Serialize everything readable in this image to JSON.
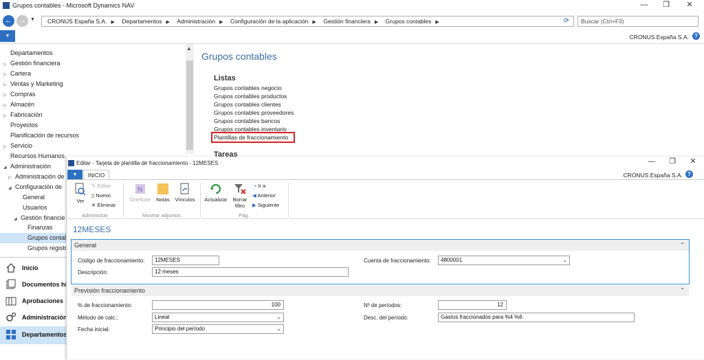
{
  "window": {
    "title": "Grupos contables - Microsoft Dynamics NAV",
    "minimize": "—",
    "maximize": "❐",
    "close": "✕"
  },
  "address": {
    "segments": [
      "CRONUS España S.A.",
      "Departamentos",
      "Administración",
      "Configuración de la aplicación",
      "Gestión financiera",
      "Grupos contables"
    ],
    "search_placeholder": "Buscar (Ctrl+F3)"
  },
  "company": "CRONUS España S.A.",
  "nav": {
    "items": [
      {
        "label": "Departamentos",
        "tri": ""
      },
      {
        "label": "Gestión financiera",
        "tri": "▷"
      },
      {
        "label": "Cartera",
        "tri": "▷"
      },
      {
        "label": "Ventas y Marketing",
        "tri": "▷"
      },
      {
        "label": "Compras",
        "tri": "▷"
      },
      {
        "label": "Almacén",
        "tri": "▷"
      },
      {
        "label": "Fabricación",
        "tri": "▷"
      },
      {
        "label": "Proyectos",
        "tri": ""
      },
      {
        "label": "Planificación de recursos",
        "tri": ""
      },
      {
        "label": "Servicio",
        "tri": "▷"
      },
      {
        "label": "Recursos Humanos",
        "tri": ""
      },
      {
        "label": "Administración",
        "tri": "◢"
      },
      {
        "label": "Administración de",
        "tri": "▷"
      },
      {
        "label": "Configuración de",
        "tri": "◢"
      },
      {
        "label": "General",
        "tri": ""
      },
      {
        "label": "Usuarios",
        "tri": ""
      },
      {
        "label": "Gestión financie",
        "tri": "◢"
      },
      {
        "label": "Finanzas",
        "tri": ""
      },
      {
        "label": "Grupos contal",
        "tri": ""
      },
      {
        "label": "Grupos registr",
        "tri": ""
      }
    ],
    "bottom": [
      "Inicio",
      "Documentos hi",
      "Aprobaciones",
      "Administración",
      "Departamentos"
    ]
  },
  "content": {
    "title": "Grupos contables",
    "listas_header": "Listas",
    "links": [
      "Grupos contables negocio",
      "Grupos contables productos",
      "Grupos contables clientes",
      "Grupos contables proveedores",
      "Grupos contables bancos",
      "Grupos contables inventario",
      "Plantillas de fraccionamiento"
    ],
    "tareas_header": "Tareas"
  },
  "dialog": {
    "title": "Editar - Tarjeta de plantilla de fraccionamiento - 12MESES",
    "tab": "INICIO",
    "ribbon": {
      "ver": "Ver",
      "editar": "Editar",
      "nuevo": "Nuevo",
      "eliminar": "Eliminar",
      "group_administrar": "Administrar",
      "onenote": "OneNote",
      "notas": "Notas",
      "vinculos": "Vínculos",
      "group_adjuntos": "Mostrar adjuntos",
      "actualizar": "Actualizar",
      "borrar_filtro_1": "Borrar",
      "borrar_filtro_2": "filtro",
      "ir_a": "Ir a",
      "anterior": "Anterior",
      "siguiente": "Siguiente",
      "group_pag": "Pág."
    },
    "card_title": "12MESES",
    "general": {
      "header": "General",
      "codigo_label": "Código de fraccionamiento:",
      "codigo_value": "12MESES",
      "descripcion_label": "Descripción:",
      "descripcion_value": "12 meses",
      "cuenta_label": "Cuenta de fraccionamiento:",
      "cuenta_value": "4800001"
    },
    "prevision": {
      "header": "Previsión fraccionamiento",
      "porc_label": "% de fraccionamiento:",
      "porc_value": "100",
      "metodo_label": "Método de calc.:",
      "metodo_value": "Lineal",
      "fecha_label": "Fecha inicial:",
      "fecha_value": "Principio del período",
      "nperiodos_label": "Nº de períodos:",
      "nperiodos_value": "12",
      "desc_periodo_label": "Desc. del período:",
      "desc_periodo_value": "Gastos fraccionados para %4 %6"
    }
  }
}
